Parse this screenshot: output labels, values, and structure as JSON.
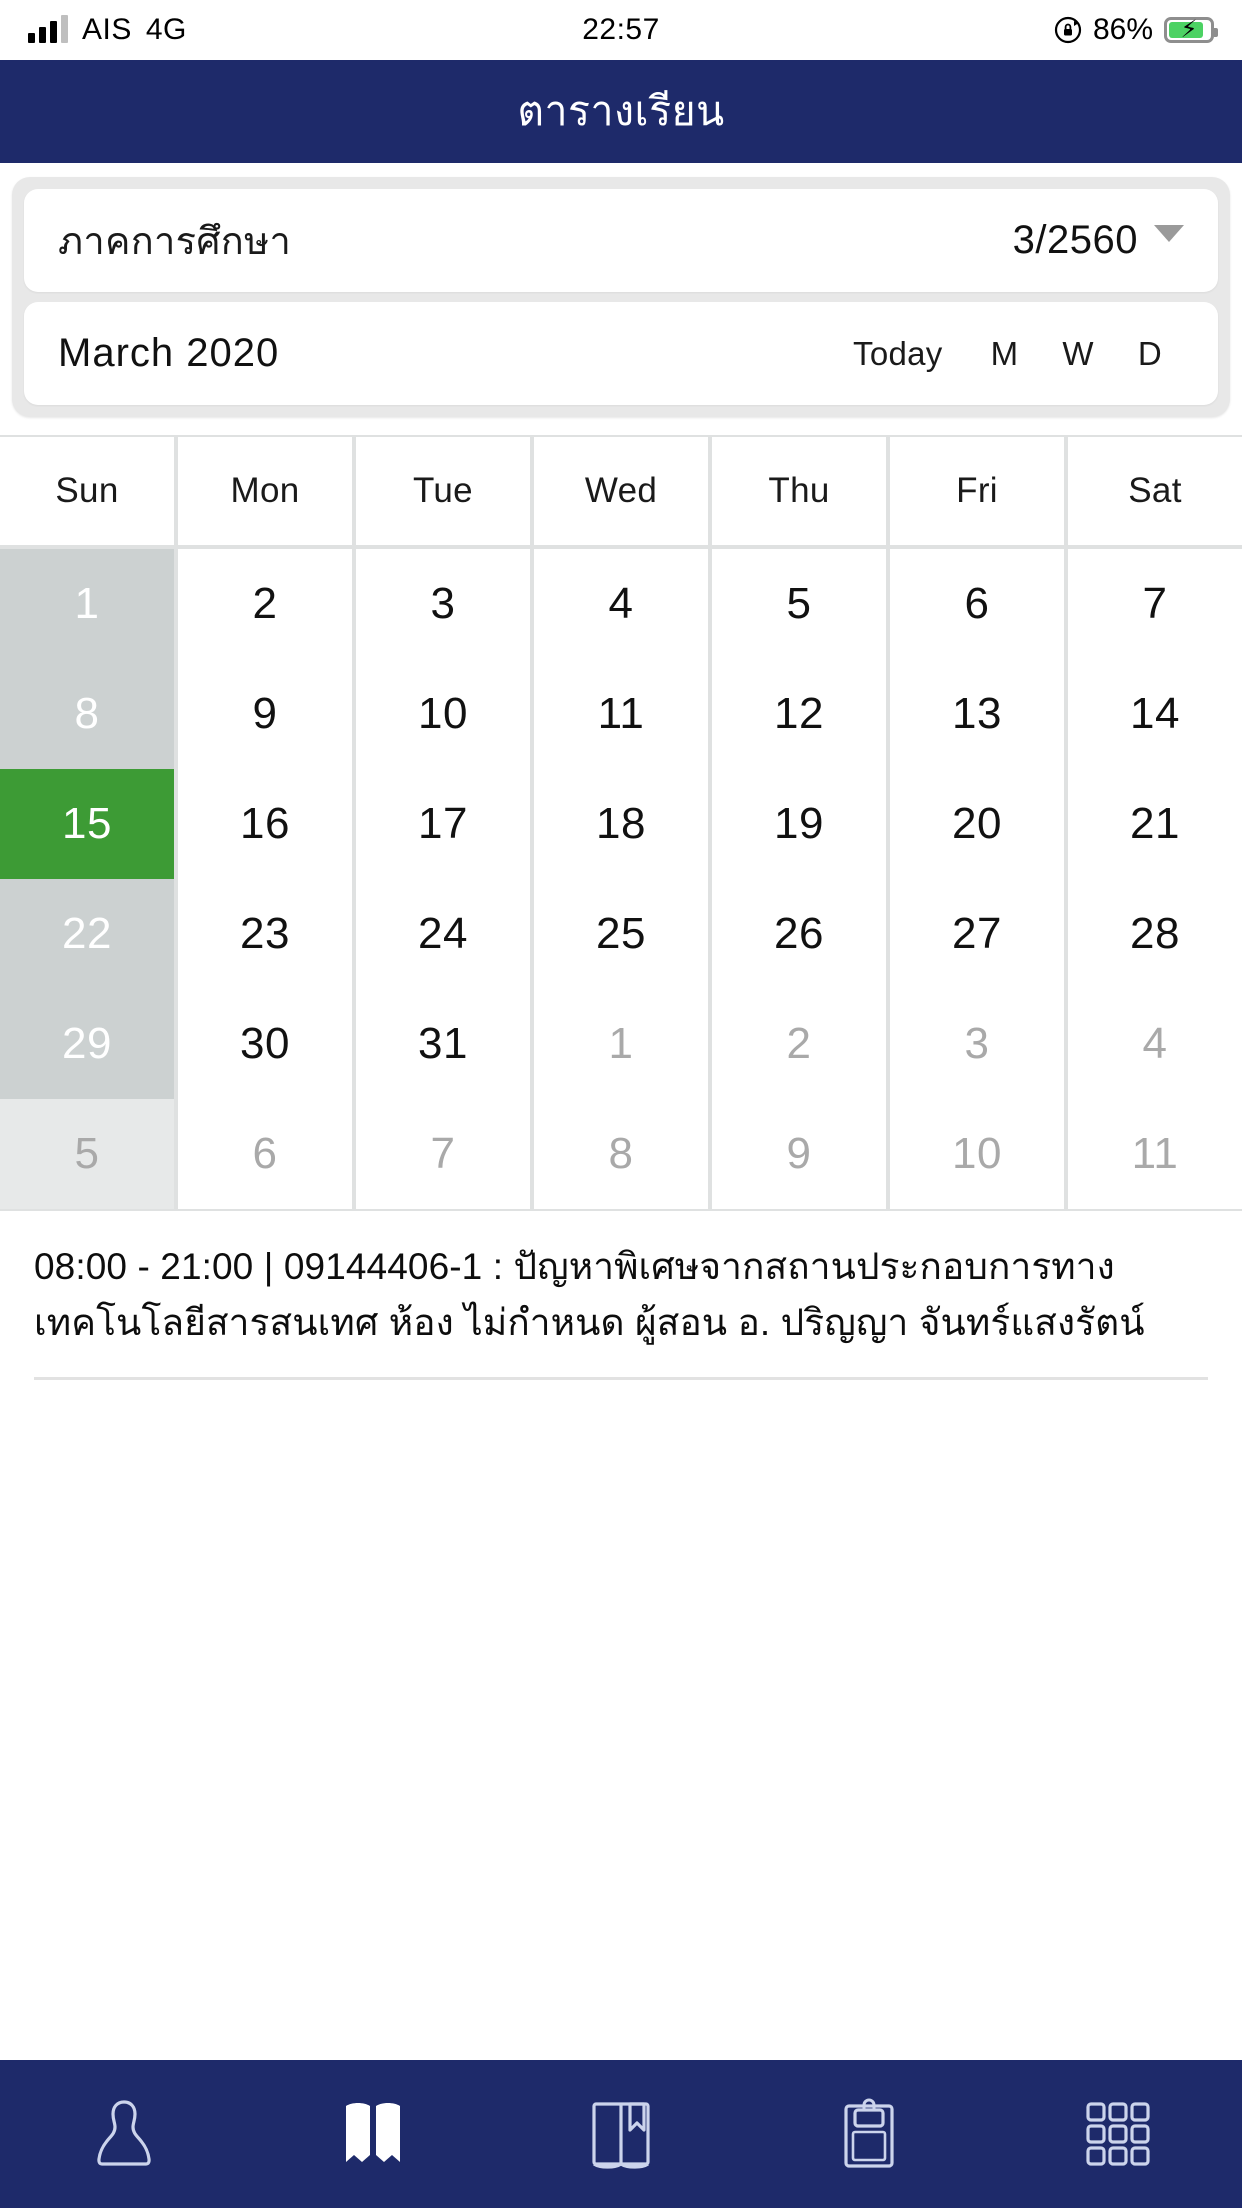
{
  "status_bar": {
    "carrier": "AIS",
    "network": "4G",
    "time": "22:57",
    "battery_percent": "86%",
    "rotation_lock_icon": "rotation-lock-icon",
    "signal_icon": "signal-bars-icon",
    "battery_icon": "battery-charging-icon"
  },
  "header": {
    "title": "ตารางเรียน"
  },
  "semester_card": {
    "label": "ภาคการศึกษา",
    "value": "3/2560",
    "caret_icon": "chevron-down-icon"
  },
  "month_card": {
    "month_label": "March 2020",
    "toggles": [
      {
        "label": "Today",
        "name": "today"
      },
      {
        "label": "M",
        "name": "month"
      },
      {
        "label": "W",
        "name": "week"
      },
      {
        "label": "D",
        "name": "day"
      }
    ]
  },
  "calendar": {
    "day_headers": [
      "Sun",
      "Mon",
      "Tue",
      "Wed",
      "Thu",
      "Fri",
      "Sat"
    ],
    "selected_day": "15",
    "selected_color": "#3d9b35",
    "sunday_bg": "#ccd1d1",
    "weeks": [
      [
        {
          "d": "1",
          "sunday": true,
          "other": false,
          "selected": false
        },
        {
          "d": "2",
          "sunday": false,
          "other": false,
          "selected": false
        },
        {
          "d": "3",
          "sunday": false,
          "other": false,
          "selected": false
        },
        {
          "d": "4",
          "sunday": false,
          "other": false,
          "selected": false
        },
        {
          "d": "5",
          "sunday": false,
          "other": false,
          "selected": false
        },
        {
          "d": "6",
          "sunday": false,
          "other": false,
          "selected": false
        },
        {
          "d": "7",
          "sunday": false,
          "other": false,
          "selected": false
        }
      ],
      [
        {
          "d": "8",
          "sunday": true,
          "other": false,
          "selected": false
        },
        {
          "d": "9",
          "sunday": false,
          "other": false,
          "selected": false
        },
        {
          "d": "10",
          "sunday": false,
          "other": false,
          "selected": false
        },
        {
          "d": "11",
          "sunday": false,
          "other": false,
          "selected": false
        },
        {
          "d": "12",
          "sunday": false,
          "other": false,
          "selected": false
        },
        {
          "d": "13",
          "sunday": false,
          "other": false,
          "selected": false
        },
        {
          "d": "14",
          "sunday": false,
          "other": false,
          "selected": false
        }
      ],
      [
        {
          "d": "15",
          "sunday": true,
          "other": false,
          "selected": true
        },
        {
          "d": "16",
          "sunday": false,
          "other": false,
          "selected": false
        },
        {
          "d": "17",
          "sunday": false,
          "other": false,
          "selected": false
        },
        {
          "d": "18",
          "sunday": false,
          "other": false,
          "selected": false
        },
        {
          "d": "19",
          "sunday": false,
          "other": false,
          "selected": false
        },
        {
          "d": "20",
          "sunday": false,
          "other": false,
          "selected": false
        },
        {
          "d": "21",
          "sunday": false,
          "other": false,
          "selected": false
        }
      ],
      [
        {
          "d": "22",
          "sunday": true,
          "other": false,
          "selected": false
        },
        {
          "d": "23",
          "sunday": false,
          "other": false,
          "selected": false
        },
        {
          "d": "24",
          "sunday": false,
          "other": false,
          "selected": false
        },
        {
          "d": "25",
          "sunday": false,
          "other": false,
          "selected": false
        },
        {
          "d": "26",
          "sunday": false,
          "other": false,
          "selected": false
        },
        {
          "d": "27",
          "sunday": false,
          "other": false,
          "selected": false
        },
        {
          "d": "28",
          "sunday": false,
          "other": false,
          "selected": false
        }
      ],
      [
        {
          "d": "29",
          "sunday": true,
          "other": false,
          "selected": false
        },
        {
          "d": "30",
          "sunday": false,
          "other": false,
          "selected": false
        },
        {
          "d": "31",
          "sunday": false,
          "other": false,
          "selected": false
        },
        {
          "d": "1",
          "sunday": false,
          "other": true,
          "selected": false
        },
        {
          "d": "2",
          "sunday": false,
          "other": true,
          "selected": false
        },
        {
          "d": "3",
          "sunday": false,
          "other": true,
          "selected": false
        },
        {
          "d": "4",
          "sunday": false,
          "other": true,
          "selected": false
        }
      ],
      [
        {
          "d": "5",
          "sunday": true,
          "other": true,
          "selected": false
        },
        {
          "d": "6",
          "sunday": false,
          "other": true,
          "selected": false
        },
        {
          "d": "7",
          "sunday": false,
          "other": true,
          "selected": false
        },
        {
          "d": "8",
          "sunday": false,
          "other": true,
          "selected": false
        },
        {
          "d": "9",
          "sunday": false,
          "other": true,
          "selected": false
        },
        {
          "d": "10",
          "sunday": false,
          "other": true,
          "selected": false
        },
        {
          "d": "11",
          "sunday": false,
          "other": true,
          "selected": false
        }
      ]
    ]
  },
  "events": [
    {
      "text": "08:00 - 21:00 | 09144406-1 : ปัญหาพิเศษจากสถานประกอบการทางเทคโนโลยีสารสนเทศ ห้อง ไม่กำหนด ผู้สอน อ. ปริญญา จันทร์แสงรัตน์",
      "start_time": "08:00",
      "end_time": "21:00",
      "course_code": "09144406-1",
      "course_name": "ปัญหาพิเศษจากสถานประกอบการทางเทคโนโลยีสารสนเทศ",
      "room": "ไม่กำหนด",
      "instructor": "อ. ปริญญา จันทร์แสงรัตน์"
    }
  ],
  "bottom_nav": {
    "active_index": 1,
    "items": [
      {
        "name": "profile",
        "icon": "person-icon"
      },
      {
        "name": "schedule",
        "icon": "open-book-filled-icon"
      },
      {
        "name": "grades",
        "icon": "book-bookmark-icon"
      },
      {
        "name": "records",
        "icon": "clipboard-icon"
      },
      {
        "name": "more",
        "icon": "grid-apps-icon"
      }
    ]
  },
  "theme": {
    "navy": "#1e2a6a",
    "green": "#3d9b35",
    "card_bg": "#e8e8e8",
    "grid_line": "#dfe1e1"
  }
}
